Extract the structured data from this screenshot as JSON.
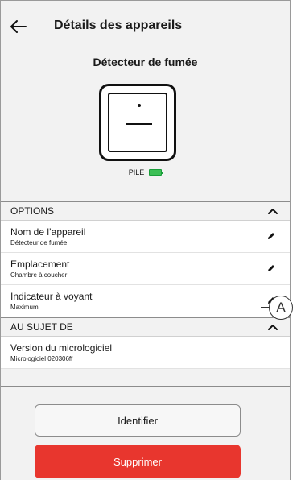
{
  "header": {
    "title": "Détails des appareils",
    "back_icon": "arrow-left-icon"
  },
  "device": {
    "name": "Détecteur de fumée",
    "battery_label": "PILE",
    "battery_level_color": "#3cbf55"
  },
  "options": {
    "heading": "OPTIONS",
    "rows": [
      {
        "label": "Nom de l’appareil",
        "value": "Détecteur de fumée"
      },
      {
        "label": "Emplacement",
        "value": "Chambre à coucher"
      },
      {
        "label": "Indicateur à voyant",
        "value": "Maximum"
      }
    ]
  },
  "about": {
    "heading": "AU SUJET DE",
    "rows": [
      {
        "label": "Version du micrologiciel",
        "value": "Micrologiciel 020306ff"
      }
    ]
  },
  "buttons": {
    "identify": "Identifier",
    "delete": "Supprimer",
    "delete_color": "#e8362e"
  },
  "callout": {
    "label": "A"
  }
}
